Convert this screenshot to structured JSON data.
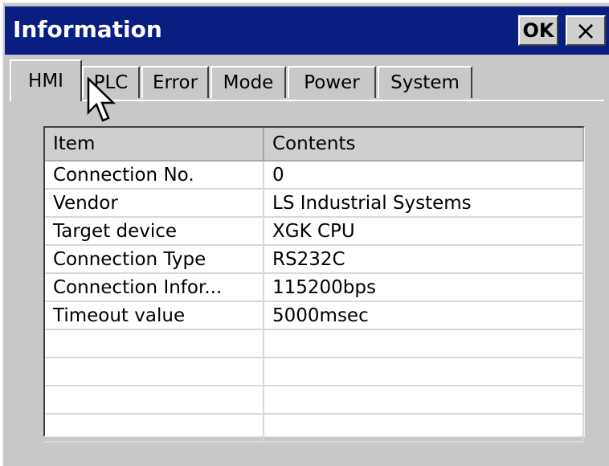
{
  "window": {
    "title": "Information",
    "ok_label": "OK",
    "close_label": "×"
  },
  "tabs": [
    "HMI",
    "PLC",
    "Error",
    "Mode",
    "Power",
    "System"
  ],
  "active_tab": "HMI",
  "table": {
    "headers": [
      "Item",
      "Contents"
    ],
    "rows": [
      [
        "Connection No.",
        "0"
      ],
      [
        "Vendor",
        "LS Industrial Systems"
      ],
      [
        "Target device",
        "XGK CPU"
      ],
      [
        "Connection Type",
        "RS232C"
      ],
      [
        "Connection Infor...",
        "115200bps"
      ],
      [
        "Timeout value",
        "5000msec"
      ],
      [
        "",
        ""
      ],
      [
        "",
        ""
      ],
      [
        "",
        ""
      ],
      [
        "",
        ""
      ]
    ]
  },
  "colors": {
    "titlebar": "#0a1d80",
    "dialog_bg": "#c8c8c8",
    "grid_line": "#d8d8d8"
  },
  "icons": {
    "cursor": "arrow-cursor-icon"
  }
}
